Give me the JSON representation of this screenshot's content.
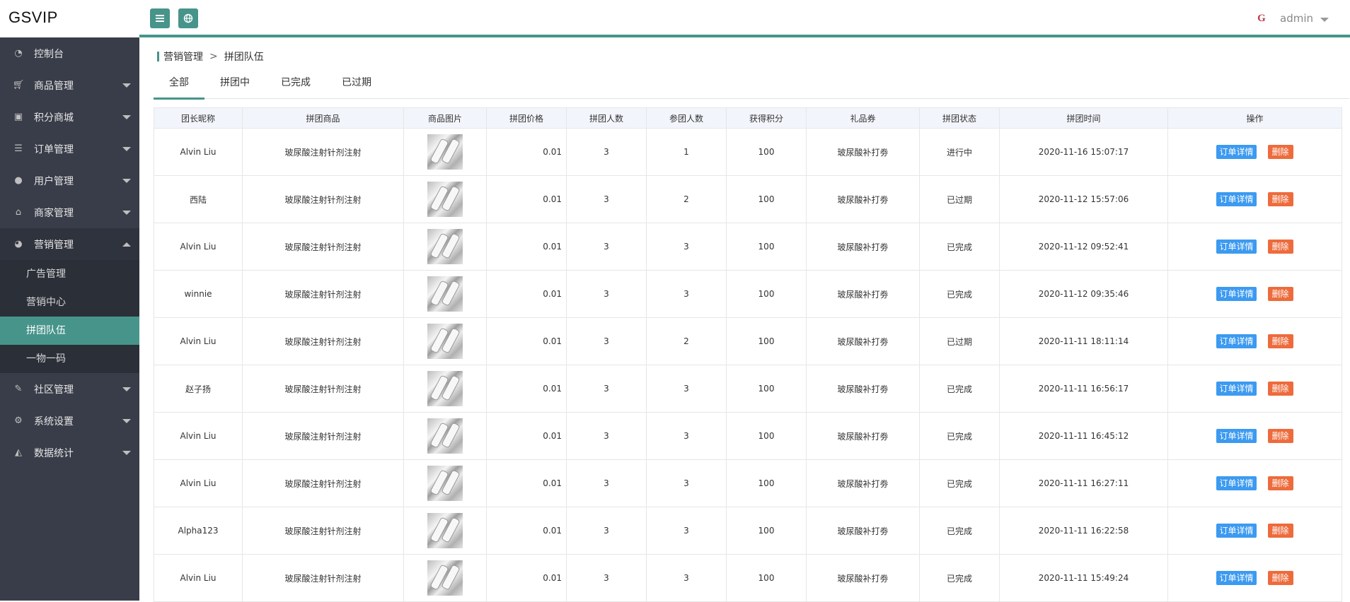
{
  "app": {
    "logo": "GSVIP"
  },
  "user": {
    "avatar_text": "G",
    "name": "admin"
  },
  "sidebar": {
    "items": [
      {
        "label": "控制台",
        "icon": "dashboard-icon",
        "has_arrow": false
      },
      {
        "label": "商品管理",
        "icon": "cart-icon",
        "has_arrow": true
      },
      {
        "label": "积分商城",
        "icon": "gift-icon",
        "has_arrow": true
      },
      {
        "label": "订单管理",
        "icon": "list-icon",
        "has_arrow": true
      },
      {
        "label": "用户管理",
        "icon": "users-icon",
        "has_arrow": true
      },
      {
        "label": "商家管理",
        "icon": "home-icon",
        "has_arrow": true
      },
      {
        "label": "营销管理",
        "icon": "speedometer-icon",
        "has_arrow": true,
        "open": true
      },
      {
        "label": "社区管理",
        "icon": "wrench-icon",
        "has_arrow": true
      },
      {
        "label": "系统设置",
        "icon": "gears-icon",
        "has_arrow": true
      },
      {
        "label": "数据统计",
        "icon": "area-chart-icon",
        "has_arrow": true
      }
    ],
    "submenu": [
      {
        "label": "广告管理"
      },
      {
        "label": "营销中心"
      },
      {
        "label": "拼团队伍",
        "active": true
      },
      {
        "label": "一物一码"
      }
    ]
  },
  "breadcrumb": {
    "parent": "营销管理",
    "separator": ">",
    "current": "拼团队伍"
  },
  "tabs": [
    {
      "label": "全部",
      "active": true
    },
    {
      "label": "拼团中"
    },
    {
      "label": "已完成"
    },
    {
      "label": "已过期"
    }
  ],
  "table": {
    "headers": [
      "团长昵称",
      "拼团商品",
      "商品图片",
      "拼团价格",
      "拼团人数",
      "参团人数",
      "获得积分",
      "礼品券",
      "拼团状态",
      "拼团时间",
      "操作"
    ],
    "detail_label": "订单详情",
    "delete_label": "删除",
    "rows": [
      {
        "leader": "Alvin Liu",
        "product": "玻尿酸注射针剂注射",
        "price": "0.01",
        "group_size": "3",
        "joined": "1",
        "points": "100",
        "coupon": "玻尿酸补打劵",
        "status": "进行中",
        "time": "2020-11-16 15:07:17"
      },
      {
        "leader": "西陆",
        "product": "玻尿酸注射针剂注射",
        "price": "0.01",
        "group_size": "3",
        "joined": "2",
        "points": "100",
        "coupon": "玻尿酸补打劵",
        "status": "已过期",
        "time": "2020-11-12 15:57:06"
      },
      {
        "leader": "Alvin Liu",
        "product": "玻尿酸注射针剂注射",
        "price": "0.01",
        "group_size": "3",
        "joined": "3",
        "points": "100",
        "coupon": "玻尿酸补打劵",
        "status": "已完成",
        "time": "2020-11-12 09:52:41"
      },
      {
        "leader": "winnie",
        "product": "玻尿酸注射针剂注射",
        "price": "0.01",
        "group_size": "3",
        "joined": "3",
        "points": "100",
        "coupon": "玻尿酸补打劵",
        "status": "已完成",
        "time": "2020-11-12 09:35:46"
      },
      {
        "leader": "Alvin Liu",
        "product": "玻尿酸注射针剂注射",
        "price": "0.01",
        "group_size": "3",
        "joined": "2",
        "points": "100",
        "coupon": "玻尿酸补打劵",
        "status": "已过期",
        "time": "2020-11-11 18:11:14"
      },
      {
        "leader": "赵子扬",
        "product": "玻尿酸注射针剂注射",
        "price": "0.01",
        "group_size": "3",
        "joined": "3",
        "points": "100",
        "coupon": "玻尿酸补打劵",
        "status": "已完成",
        "time": "2020-11-11 16:56:17"
      },
      {
        "leader": "Alvin Liu",
        "product": "玻尿酸注射针剂注射",
        "price": "0.01",
        "group_size": "3",
        "joined": "3",
        "points": "100",
        "coupon": "玻尿酸补打劵",
        "status": "已完成",
        "time": "2020-11-11 16:45:12"
      },
      {
        "leader": "Alvin Liu",
        "product": "玻尿酸注射针剂注射",
        "price": "0.01",
        "group_size": "3",
        "joined": "3",
        "points": "100",
        "coupon": "玻尿酸补打劵",
        "status": "已完成",
        "time": "2020-11-11 16:27:11"
      },
      {
        "leader": "Alpha123",
        "product": "玻尿酸注射针剂注射",
        "price": "0.01",
        "group_size": "3",
        "joined": "3",
        "points": "100",
        "coupon": "玻尿酸补打劵",
        "status": "已完成",
        "time": "2020-11-11 16:22:58"
      },
      {
        "leader": "Alvin Liu",
        "product": "玻尿酸注射针剂注射",
        "price": "0.01",
        "group_size": "3",
        "joined": "3",
        "points": "100",
        "coupon": "玻尿酸补打劵",
        "status": "已完成",
        "time": "2020-11-11 15:49:24"
      }
    ]
  },
  "colors": {
    "accent": "#47948a",
    "sidebar_bg": "#393d49",
    "detail_button": "#3c9af0",
    "delete_button": "#ed6b3c"
  }
}
